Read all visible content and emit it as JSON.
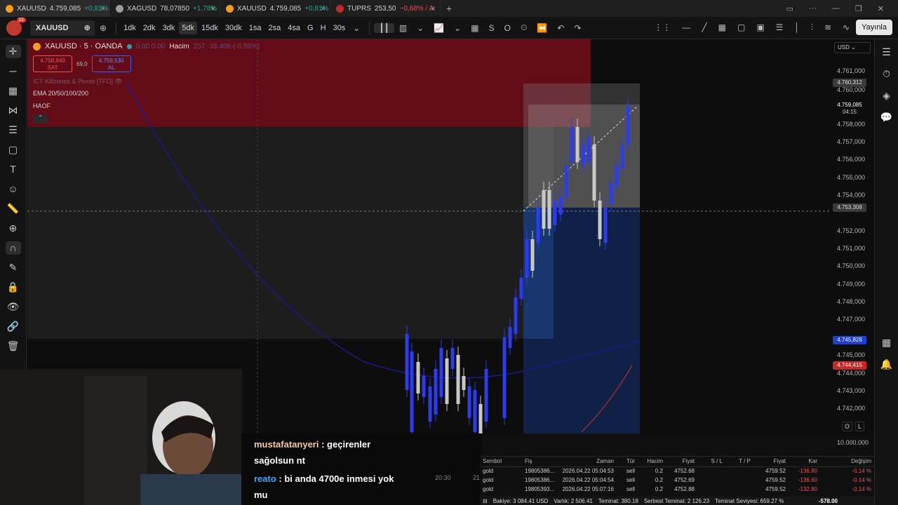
{
  "tabs": [
    {
      "symbol": "XAUUSD",
      "price": "4.759,085",
      "change": "+0,81%",
      "neg": false,
      "color": "#f0a020"
    },
    {
      "symbol": "XAGUSD",
      "price": "78,07850",
      "change": "+1,78%",
      "neg": false,
      "color": "#9e9e9e"
    },
    {
      "symbol": "XAUUSD",
      "price": "4.759,085",
      "change": "+0,81%",
      "neg": false,
      "color": "#f0a020"
    },
    {
      "symbol": "TUPRS",
      "price": "253,50",
      "change": "−0,68% / A",
      "neg": true,
      "color": "#c62828"
    }
  ],
  "toolbar": {
    "notif_count": "11",
    "symbol": "XAUUSD",
    "timeframes": [
      "1dk",
      "2dk",
      "3dk",
      "5dk",
      "15dk",
      "30dk",
      "1sa",
      "2sa",
      "4sa",
      "G",
      "H",
      "30s"
    ],
    "active_timeframe": "5dk",
    "publish_label": "Yayınla",
    "s_label": "S",
    "o_label": "O"
  },
  "legend": {
    "title": "XAUUSD · 5 · OANDA",
    "ohlc_dim": "0.00 0.00",
    "volume_label": "Hacim",
    "volume_dim": "257  -33.406 (-0.55%)",
    "sell_price": "4.758,840",
    "sell_label": "SAT",
    "spread": "69,0",
    "buy_price": "4.759,530",
    "buy_label": "AL",
    "ind1": "ICT Killzones & Pivots [TFO]",
    "ind2": "EMA 20/50/100/200",
    "ind3": "HAOF"
  },
  "price_scale": {
    "currency": "USD",
    "labels": [
      "4.761,000",
      "4.760,000",
      "4.758,000",
      "4.757,000",
      "4.756,000",
      "4.755,000",
      "4.754,000",
      "4.752,000",
      "4.751,000",
      "4.750,000",
      "4.749,000",
      "4.748,000",
      "4.747,000",
      "4.745,000",
      "4.744,000",
      "4.743,000",
      "4.742,000"
    ],
    "tag_top": "4.760,312",
    "tag_current": "4.759,085",
    "tag_countdown": "04:15",
    "tag_cross": "4.753,308",
    "tag_blue": "4.745,828",
    "tag_red": "4.744,415",
    "volume_scale": "10.000.000",
    "btn_l": "L",
    "btn_o": "O"
  },
  "chat": [
    {
      "user": "mustafatanyeri",
      "text": ": geçirenler"
    },
    {
      "user": "",
      "text": "sağolsun nt"
    },
    {
      "user": "reato",
      "text": ": bi anda 4700e inmesi yok"
    },
    {
      "user": "",
      "text": "mu"
    }
  ],
  "time_axis": [
    "20:30",
    "21"
  ],
  "orders": {
    "headers": [
      "Sembol",
      "Fiş",
      "Zaman",
      "Tür",
      "Hacim",
      "Fiyat",
      "S / L",
      "T / P",
      "Fiyat",
      "Kar",
      "Değişim"
    ],
    "rows": [
      [
        "gold",
        "19805386...",
        "2026.04.22 05:04:53",
        "sell",
        "0.2",
        "4752.68",
        "",
        "",
        "4759.52",
        "-136.80",
        "-0.14 %"
      ],
      [
        "gold",
        "19805386...",
        "2026.04.22 05:04:54",
        "sell",
        "0.2",
        "4752.69",
        "",
        "",
        "4759.52",
        "-136.60",
        "-0.14 %"
      ],
      [
        "gold",
        "19805393...",
        "2026.04.22 05:07:16",
        "sell",
        "0.2",
        "4752.88",
        "",
        "",
        "4759.52",
        "-132.80",
        "-0.14 %"
      ]
    ],
    "footer": [
      "Bakiye: 3 084.41 USD",
      "Varlık: 2 506.41",
      "Teminat: 380.18",
      "Serbest Teminat: 2 126.23",
      "Teminat Seviyesi: 659.27 %"
    ],
    "total": "-578.00"
  },
  "colors": {
    "bull": "#2a3bf0",
    "bear": "#c8c8c8",
    "accent": "#2962ff",
    "red": "#e53935"
  }
}
